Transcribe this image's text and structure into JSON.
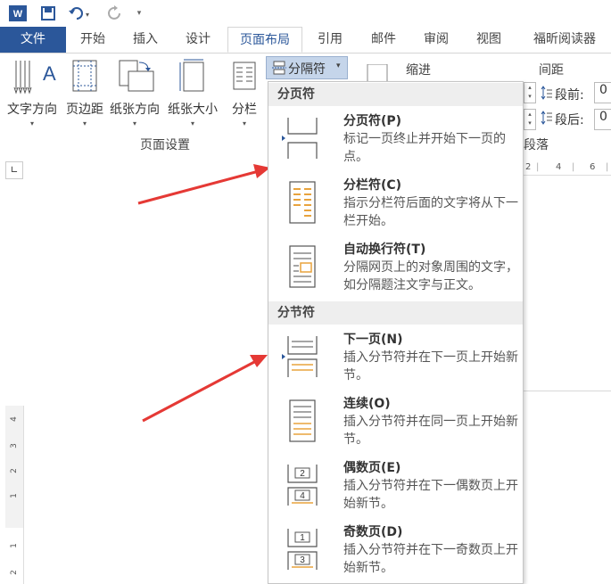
{
  "qat": {
    "icons": [
      "word-logo-icon",
      "save-icon",
      "undo-icon",
      "redo-icon",
      "customize-icon"
    ]
  },
  "tabs": [
    {
      "label": "文件"
    },
    {
      "label": "开始"
    },
    {
      "label": "插入"
    },
    {
      "label": "设计"
    },
    {
      "label": "页面布局"
    },
    {
      "label": "引用"
    },
    {
      "label": "邮件"
    },
    {
      "label": "审阅"
    },
    {
      "label": "视图"
    },
    {
      "label": "福昕阅读器"
    }
  ],
  "ribbon": {
    "text_direction": "文字方向",
    "margins": "页边距",
    "orientation": "纸张方向",
    "size": "纸张大小",
    "columns": "分栏",
    "breaks": "分隔符",
    "group_page_setup": "页面设置",
    "indent": "缩进",
    "spacing": "间距",
    "before": "段前:",
    "after": "段后:",
    "before_value": "0",
    "after_value": "0",
    "paragraph_group": "段落"
  },
  "ruler": {
    "h_ticks": [
      "2",
      "4",
      "6"
    ],
    "v_ticks": [
      "4",
      "3",
      "2",
      "1",
      "1",
      "2"
    ]
  },
  "menu": {
    "section_page_breaks": "分页符",
    "section_section_breaks": "分节符",
    "items": [
      {
        "title": "分页符(P)",
        "desc": "标记一页终止并开始下一页的点。",
        "icon": "page-break-icon"
      },
      {
        "title": "分栏符(C)",
        "desc": "指示分栏符后面的文字将从下一栏开始。",
        "icon": "column-break-icon"
      },
      {
        "title": "自动换行符(T)",
        "desc": "分隔网页上的对象周围的文字，如分隔题注文字与正文。",
        "icon": "text-wrapping-break-icon"
      },
      {
        "title": "下一页(N)",
        "desc": "插入分节符并在下一页上开始新节。",
        "icon": "next-page-break-icon"
      },
      {
        "title": "连续(O)",
        "desc": "插入分节符并在同一页上开始新节。",
        "icon": "continuous-break-icon"
      },
      {
        "title": "偶数页(E)",
        "desc": "插入分节符并在下一偶数页上开始新节。",
        "icon": "even-page-break-icon"
      },
      {
        "title": "奇数页(D)",
        "desc": "插入分节符并在下一奇数页上开始新节。",
        "icon": "odd-page-break-icon"
      }
    ]
  },
  "colors": {
    "accent": "#2b579a",
    "arrow": "#e53935",
    "icon_orange": "#e8a33d"
  }
}
